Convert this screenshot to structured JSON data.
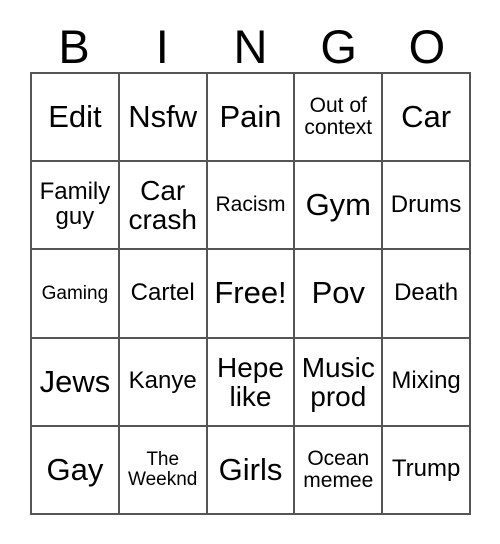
{
  "card": {
    "title": "BINGO",
    "header_letters": [
      "B",
      "I",
      "N",
      "G",
      "O"
    ],
    "columns": 5,
    "rows": 5,
    "colors": {
      "background": "#ffffff",
      "text": "#000000",
      "grid_line": "#555555"
    },
    "cells": [
      {
        "label": "Edit",
        "size": "xl"
      },
      {
        "label": "Nsfw",
        "size": "xl"
      },
      {
        "label": "Pain",
        "size": "xl"
      },
      {
        "label": "Out of\ncontext",
        "size": "sm"
      },
      {
        "label": "Car",
        "size": "xl"
      },
      {
        "label": "Family\nguy",
        "size": "md"
      },
      {
        "label": "Car\ncrash",
        "size": "lg"
      },
      {
        "label": "Racism",
        "size": "sm"
      },
      {
        "label": "Gym",
        "size": "xl"
      },
      {
        "label": "Drums",
        "size": "md"
      },
      {
        "label": "Gaming",
        "size": "xs"
      },
      {
        "label": "Cartel",
        "size": "md"
      },
      {
        "label": "Free!",
        "size": "xl"
      },
      {
        "label": "Pov",
        "size": "xl"
      },
      {
        "label": "Death",
        "size": "md"
      },
      {
        "label": "Jews",
        "size": "xl"
      },
      {
        "label": "Kanye",
        "size": "md"
      },
      {
        "label": "Hepe\nlike",
        "size": "lg"
      },
      {
        "label": "Music\nprod",
        "size": "lg"
      },
      {
        "label": "Mixing",
        "size": "md"
      },
      {
        "label": "Gay",
        "size": "xl"
      },
      {
        "label": "The\nWeeknd",
        "size": "xs"
      },
      {
        "label": "Girls",
        "size": "xl"
      },
      {
        "label": "Ocean\nmemee",
        "size": "sm"
      },
      {
        "label": "Trump",
        "size": "md"
      }
    ]
  }
}
